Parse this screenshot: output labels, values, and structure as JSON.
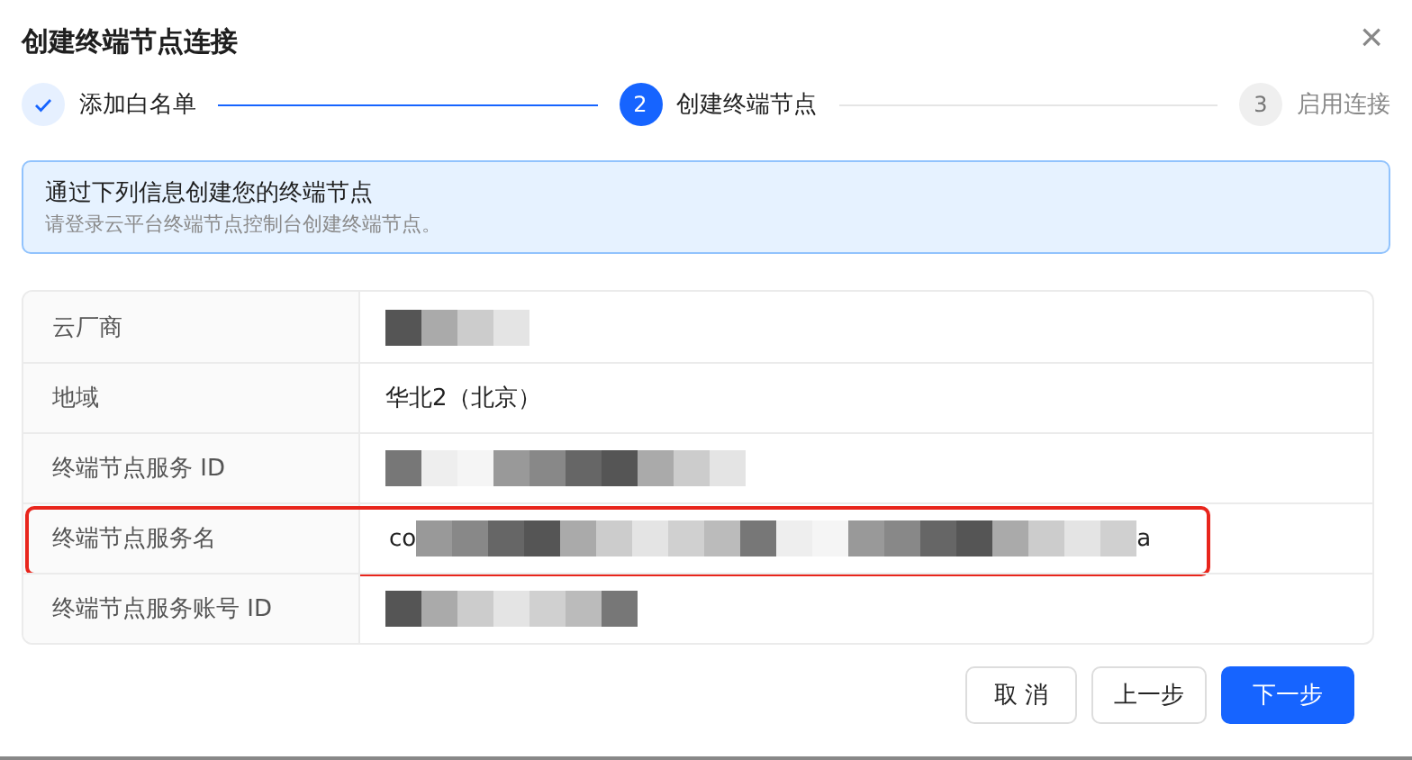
{
  "dialog": {
    "title": "创建终端节点连接",
    "close": "×"
  },
  "steps": [
    {
      "label": "添加白名单",
      "completed": true,
      "selected": false
    },
    {
      "number": "2",
      "label": "创建终端节点",
      "completed": false,
      "selected": true
    },
    {
      "number": "3",
      "label": "启用连接",
      "completed": false,
      "selected": false
    }
  ],
  "alert": {
    "title": "通过下列信息创建您的终端节点",
    "description": "请登录云平台终端节点控制台创建终端节点。"
  },
  "table": {
    "rows": [
      {
        "label": "云厂商",
        "kind": "redacted",
        "highlighted": false
      },
      {
        "label": "地域",
        "kind": "text",
        "value": "华北2（北京）",
        "highlighted": false
      },
      {
        "label": "终端节点服务 ID",
        "kind": "redacted",
        "highlighted": false
      },
      {
        "label": "终端节点服务名",
        "kind": "redacted",
        "prefix": "co",
        "suffix": "a",
        "highlighted": true
      },
      {
        "label": "终端节点服务账号 ID",
        "kind": "redacted",
        "highlighted": false
      }
    ]
  },
  "buttons": [
    {
      "label": "取 消",
      "kind": "default"
    },
    {
      "label": "上一步",
      "kind": "default"
    },
    {
      "label": "下一步",
      "kind": "primary"
    }
  ]
}
